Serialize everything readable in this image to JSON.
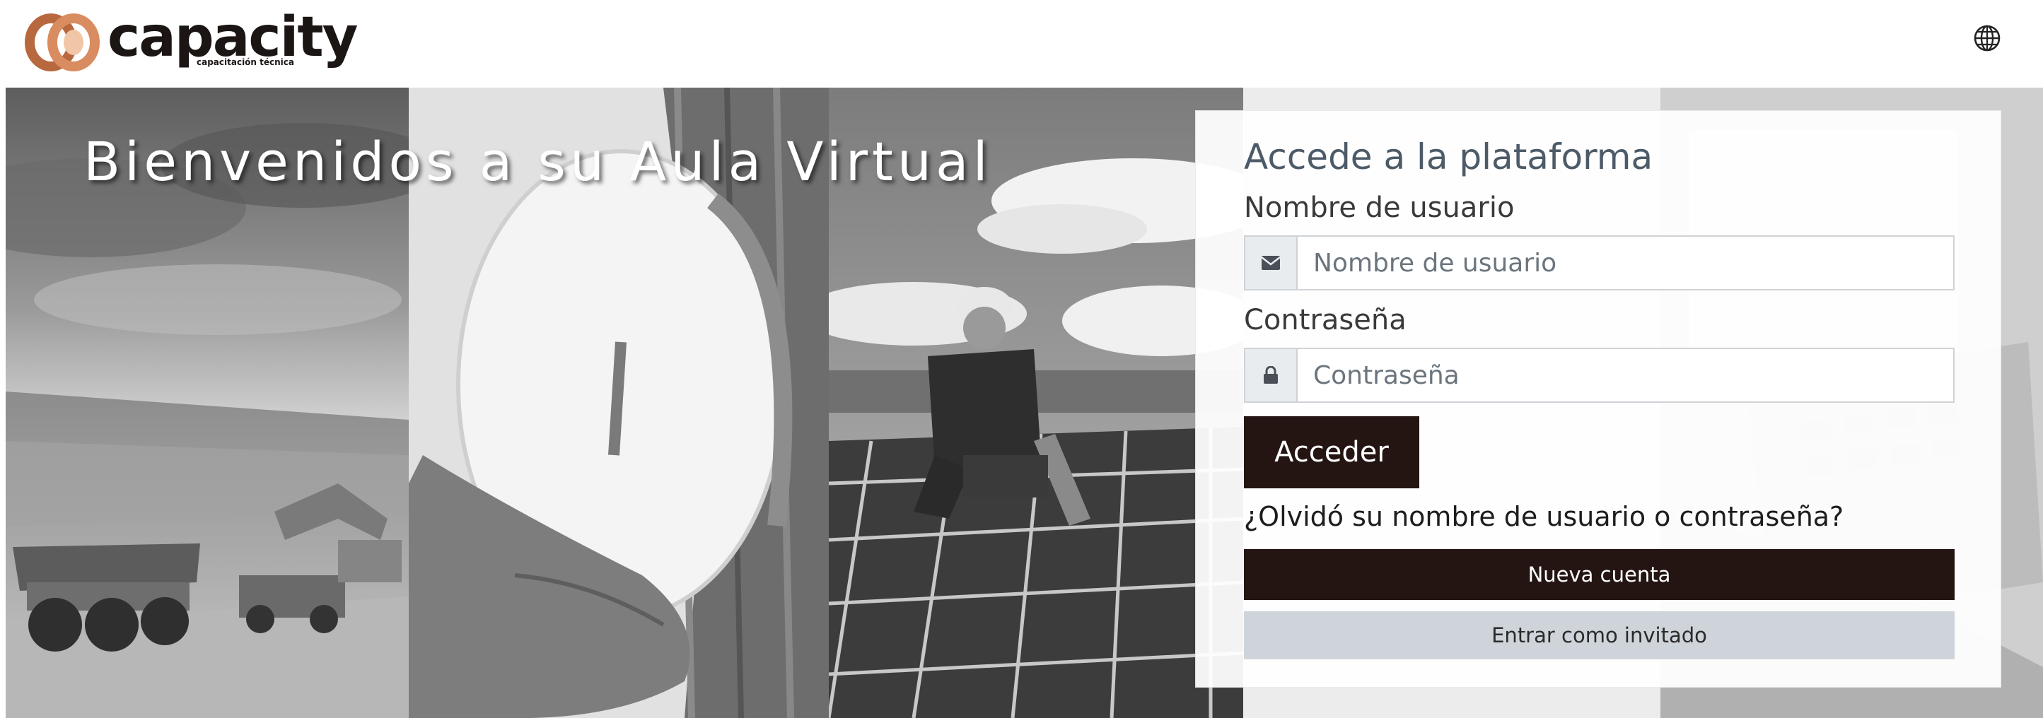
{
  "brand": {
    "name": "capacity",
    "tagline": "capacitación técnica",
    "logo_colors": [
      "#b8683f",
      "#e0a07a"
    ]
  },
  "header": {
    "language_icon": "globe-icon"
  },
  "hero": {
    "title": "Bienvenidos a su Aula Virtual"
  },
  "login": {
    "title": "Accede a la plataforma",
    "username_label": "Nombre de usuario",
    "username_placeholder": "Nombre de usuario",
    "username_icon": "envelope-icon",
    "password_label": "Contraseña",
    "password_placeholder": "Contraseña",
    "password_icon": "lock-icon",
    "submit_label": "Acceder",
    "forgot_link": "¿Olvidó su nombre de usuario o contraseña?",
    "new_account_label": "Nueva cuenta",
    "guest_label": "Entrar como invitado"
  },
  "colors": {
    "primary_button": "#241513",
    "secondary_button": "#ced4da",
    "title_text": "#4d5b68"
  }
}
